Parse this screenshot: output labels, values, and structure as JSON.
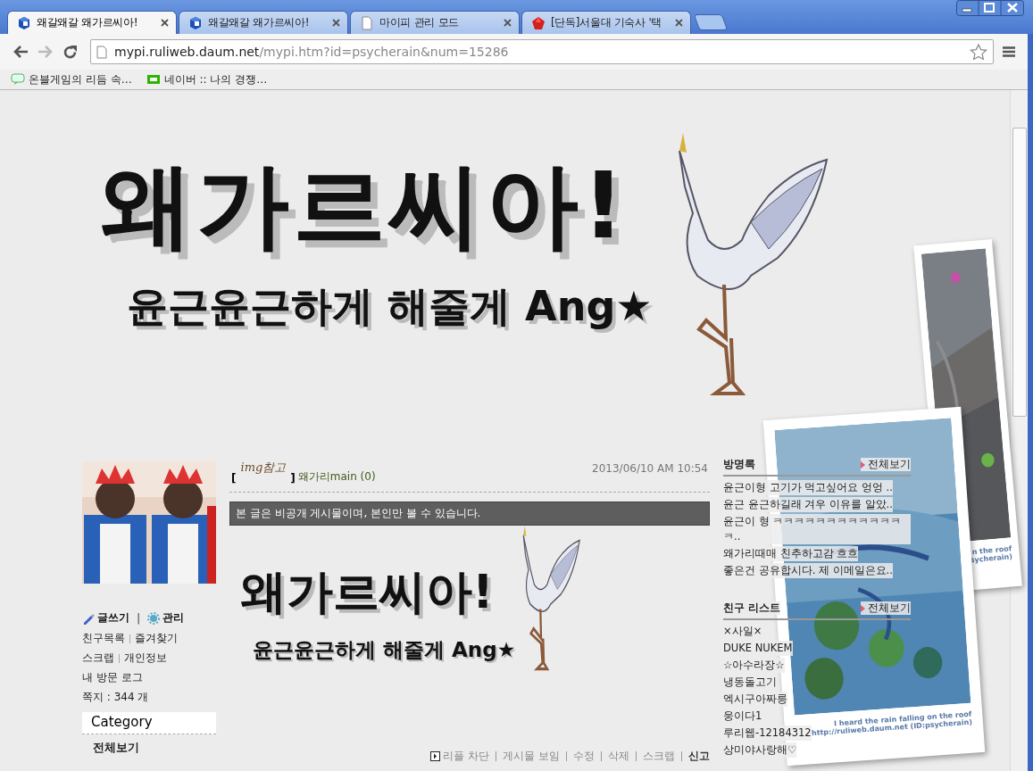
{
  "tabs": [
    {
      "title": "왜갈왜갈 왜가르씨아!",
      "kind": "blog",
      "selected": true
    },
    {
      "title": "왜갈왜갈 왜가르씨아!",
      "kind": "blog",
      "selected": false
    },
    {
      "title": "마이피 관리 모드",
      "kind": "page",
      "selected": false
    },
    {
      "title": "[단독]서울대 기숙사 '택",
      "kind": "news",
      "selected": false
    }
  ],
  "address": {
    "host": "mypi.ruliweb.daum.net",
    "path": "/mypi.htm?id=psycherain&num=15286"
  },
  "bookmarks": [
    {
      "label": "온블게임의 리듬 속…",
      "kind": "blog"
    },
    {
      "label": "네이버 :: 나의 경쟁…",
      "kind": "naver"
    }
  ],
  "banner": {
    "title": "왜가르씨아!",
    "subtitle": "윤근윤근하게 해줄게 Ang★"
  },
  "sidebar": {
    "action_separator": "|",
    "actions": [
      {
        "label": "글쓰기",
        "kind": "write"
      },
      {
        "label": "관리",
        "kind": "manage"
      }
    ],
    "link_rows": [
      [
        "친구목록",
        "즐겨찾기"
      ],
      [
        "스크랩",
        "개인정보"
      ],
      [
        "내 방문 로그"
      ],
      [
        "쪽지 : 344 개"
      ]
    ],
    "category_title": "Category",
    "categories": [
      {
        "label": "전체보기",
        "selected": true
      }
    ]
  },
  "post": {
    "tag_open": "[",
    "tag": "img참고",
    "tag_close": "]",
    "title": "왜가리main (0)",
    "date": "2013/06/10 AM 10:54",
    "notice": "본 글은 비공개 게시물이며, 본인만 볼 수 있습니다.",
    "image": {
      "title": "왜가르씨아!",
      "subtitle": "윤근윤근하게 해줄게 Ang★"
    },
    "actions": [
      {
        "label": "리플 차단",
        "kind": "toggle"
      },
      {
        "label": "게시물 보임",
        "kind": "plain"
      },
      {
        "label": "수정",
        "kind": "plain"
      },
      {
        "label": "삭제",
        "kind": "plain"
      },
      {
        "label": "스크랩",
        "kind": "plain"
      },
      {
        "label": "신고",
        "kind": "strong"
      }
    ]
  },
  "guestbook": {
    "title": "방명록",
    "more": "전체보기",
    "entries": [
      "윤근이형 고기가 먹고싶어요 엉엉 ..",
      "윤근 윤근하길래 겨우 이유를 알았..",
      "윤근이 형 ㅋㅋㅋㅋㅋㅋㅋㅋㅋㅋㅋㅋㅋ..",
      "왜가리때매 친추하고감 흐흐",
      "좋은건 공유합시다. 제 이메일은요.."
    ]
  },
  "friends": {
    "title": "친구 리스트",
    "more": "전체보기",
    "items": [
      "×사일×",
      "DUKE NUKEM",
      "☆아수라장☆",
      "냉동돌고기",
      "엑시구아짜릉",
      "웅이다1",
      "루리웹-12184312",
      "상미야사랑해♡"
    ]
  },
  "polaroids": [
    {
      "caption": "n the roof",
      "url": "sycherain)"
    },
    {
      "caption": "I heard the rain falling on the roof",
      "url": "http://ruliweb.daum.net (ID:psycherain)"
    }
  ]
}
